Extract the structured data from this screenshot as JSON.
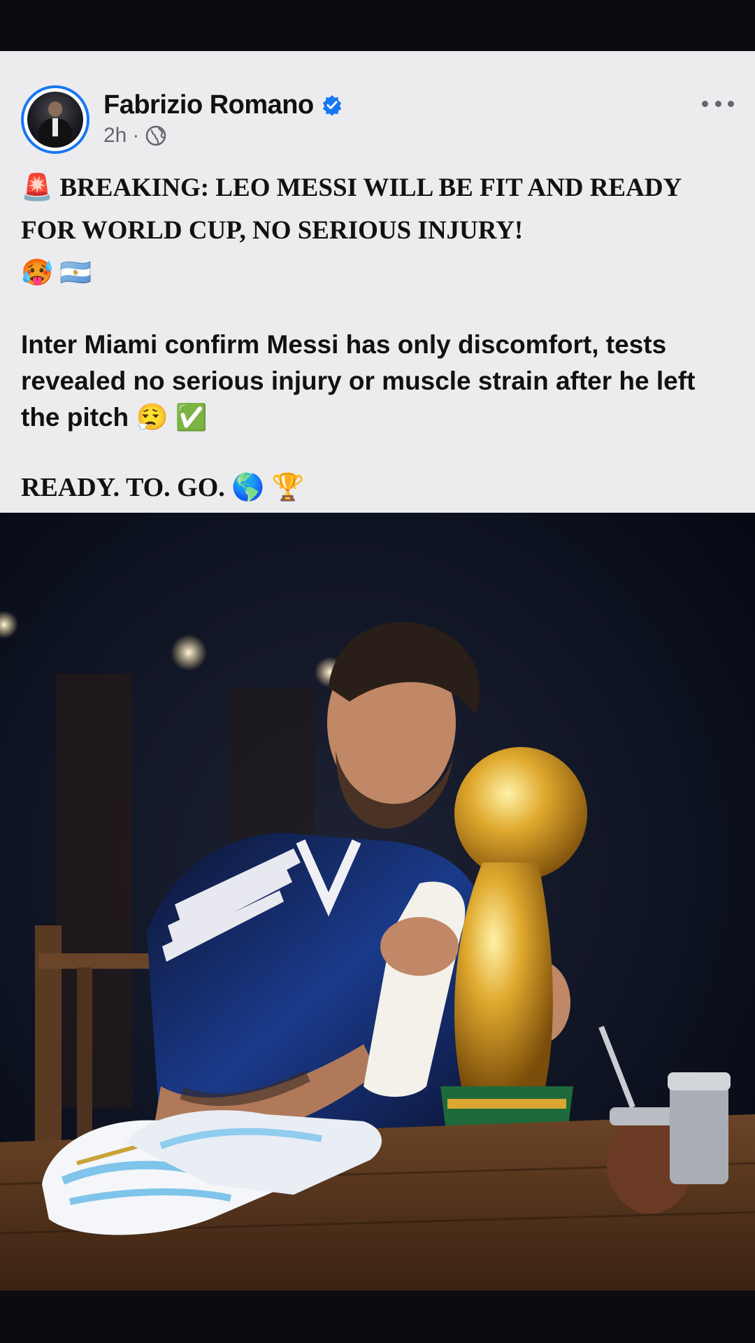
{
  "post": {
    "author_name": "Fabrizio Romano",
    "timestamp": "2h",
    "separator": "·",
    "privacy_icon": "globe-icon",
    "verified_icon": "verified-badge-icon",
    "more_icon": "more-options-icon",
    "headline": "BREAKING: LEO MESSI WILL BE FIT AND READY FOR WORLD CUP, NO SERIOUS INJURY!",
    "body": "Inter Miami confirm Messi has only discomfort, tests revealed no serious injury or muscle strain after he left the pitch",
    "closing": "READY. TO. GO.",
    "emojis": {
      "siren": "🚨",
      "hot_face": "🥵",
      "argentina_flag": "🇦🇷",
      "relieved": "😮‍💨",
      "check": "✅",
      "globe": "🌎",
      "trophy": "🏆"
    }
  },
  "photo": {
    "description_icon": "post-photo"
  },
  "colors": {
    "accent": "#1877f2",
    "card_background": "#ececef",
    "page_background": "#0b0c10",
    "meta_text": "#65676b"
  }
}
